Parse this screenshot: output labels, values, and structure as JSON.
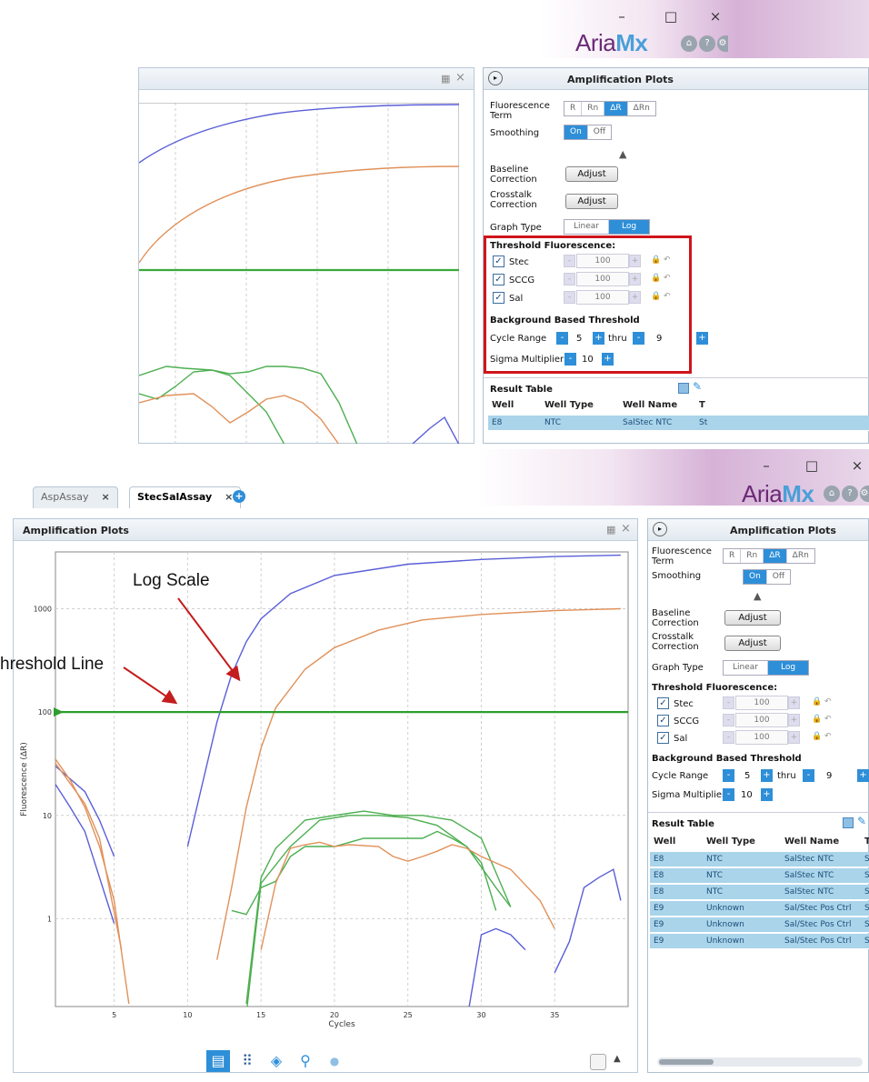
{
  "window": {
    "minimize": "–",
    "maximize": "□",
    "close": "×",
    "brand_prefix": "Aria",
    "brand_suffix": "Mx",
    "home_icon": "home-icon",
    "help_icon": "help-icon",
    "settings_icon": "settings-icon"
  },
  "tabs": [
    {
      "label": "AspAssay",
      "close": "×"
    },
    {
      "label": "StecSalAssay",
      "close": "×"
    }
  ],
  "add_tab": "+",
  "plot_panel": {
    "title": "Amplification Plots",
    "dock_icon": "▦",
    "close_icon": "×"
  },
  "controls": {
    "title": "Amplification Plots",
    "collapse_icon": "▸",
    "fluorescence_term_label": "Fluorescence Term",
    "fluorescence_term_options": [
      "R",
      "Rn",
      "ΔR",
      "ΔRn"
    ],
    "fluorescence_term_selected": "ΔR",
    "smoothing_label": "Smoothing",
    "smoothing_options": [
      "On",
      "Off"
    ],
    "smoothing_selected": "On",
    "expand_arrow": "▲",
    "baseline_label": "Baseline Correction",
    "baseline_button": "Adjust",
    "crosstalk_label": "Crosstalk Correction",
    "crosstalk_button": "Adjust",
    "graph_type_label": "Graph Type",
    "graph_type_options": [
      "Linear",
      "Log"
    ],
    "graph_type_selected": "Log",
    "threshold_title": "Threshold Fluorescence:",
    "thresholds": [
      {
        "name": "Stec",
        "value": "100",
        "checked": true
      },
      {
        "name": "SCCG",
        "value": "100",
        "checked": true
      },
      {
        "name": "Sal",
        "value": "100",
        "checked": true
      }
    ],
    "background_title": "Background Based Threshold",
    "cycle_range_label": "Cycle Range",
    "cycle_from": "5",
    "thru_label": "thru",
    "cycle_to": "9",
    "sigma_label": "Sigma Multiplier",
    "sigma_value": "10",
    "minus": "-",
    "plus": "+"
  },
  "result_table": {
    "title": "Result Table",
    "columns": [
      "Well",
      "Well Type",
      "Well Name",
      "T"
    ],
    "rows_top": [
      {
        "well": "E8",
        "type": "NTC",
        "name": "SalStec NTC",
        "t": "St"
      }
    ],
    "rows": [
      {
        "well": "E8",
        "type": "NTC",
        "name": "SalStec NTC",
        "t": "S"
      },
      {
        "well": "E8",
        "type": "NTC",
        "name": "SalStec NTC",
        "t": "S"
      },
      {
        "well": "E8",
        "type": "NTC",
        "name": "SalStec NTC",
        "t": "S"
      },
      {
        "well": "E9",
        "type": "Unknown",
        "name": "Sal/Stec Pos Ctrl",
        "t": "S"
      },
      {
        "well": "E9",
        "type": "Unknown",
        "name": "Sal/Stec Pos Ctrl",
        "t": "S"
      },
      {
        "well": "E9",
        "type": "Unknown",
        "name": "Sal/Stec Pos Ctrl",
        "t": "S"
      }
    ]
  },
  "annotations": {
    "log_scale": "Log Scale",
    "threshold_line": "hreshold Line"
  },
  "chart_data": {
    "type": "line",
    "xlabel": "Cycles",
    "ylabel": "Fluorescence (ΔR)",
    "x_ticks": [
      "5",
      "10",
      "15",
      "20",
      "25",
      "30",
      "35"
    ],
    "y_ticks": [
      "1000",
      "100",
      "10",
      "1"
    ],
    "threshold": 100,
    "xlim": [
      1,
      40
    ],
    "ylim_log10": [
      -0.85,
      3.55
    ],
    "scale": "log",
    "grid": true,
    "colors": {
      "blue": "#5a5fd6",
      "orange": "#e0915a",
      "green": "#4caf50",
      "threshold": "#2e9e2e"
    },
    "series": [
      {
        "color": "blue",
        "points": [
          [
            10,
            5
          ],
          [
            11,
            20
          ],
          [
            12,
            80
          ],
          [
            13,
            230
          ],
          [
            14,
            480
          ],
          [
            15,
            800
          ],
          [
            17,
            1400
          ],
          [
            20,
            2100
          ],
          [
            25,
            2700
          ],
          [
            30,
            3000
          ],
          [
            35,
            3200
          ],
          [
            39.5,
            3300
          ]
        ]
      },
      {
        "color": "orange",
        "points": [
          [
            12,
            0.4
          ],
          [
            13,
            2
          ],
          [
            14,
            12
          ],
          [
            15,
            45
          ],
          [
            16,
            110
          ],
          [
            18,
            260
          ],
          [
            20,
            420
          ],
          [
            23,
            620
          ],
          [
            26,
            780
          ],
          [
            30,
            880
          ],
          [
            35,
            960
          ],
          [
            39.5,
            1000
          ]
        ]
      },
      {
        "color": "blue",
        "points": [
          [
            1,
            20
          ],
          [
            2,
            12
          ],
          [
            3,
            7
          ],
          [
            4,
            2.5
          ],
          [
            5,
            0.9
          ]
        ]
      },
      {
        "color": "blue",
        "points": [
          [
            1,
            30
          ],
          [
            3,
            17
          ],
          [
            4,
            9
          ],
          [
            5,
            4
          ]
        ]
      },
      {
        "color": "orange",
        "points": [
          [
            1,
            35
          ],
          [
            2,
            22
          ],
          [
            3,
            12
          ],
          [
            4,
            5
          ],
          [
            5,
            1.5
          ],
          [
            6,
            0.15
          ]
        ]
      },
      {
        "color": "orange",
        "points": [
          [
            1,
            32
          ],
          [
            3,
            13
          ],
          [
            4,
            6
          ],
          [
            5.5,
            0.5
          ]
        ]
      },
      {
        "color": "green",
        "points": [
          [
            13,
            1.2
          ],
          [
            14,
            1.1
          ],
          [
            15,
            2
          ],
          [
            16,
            2.3
          ],
          [
            17,
            4
          ],
          [
            18,
            5
          ],
          [
            20,
            5
          ],
          [
            22,
            6
          ],
          [
            24,
            6
          ],
          [
            26,
            6
          ],
          [
            27,
            7
          ],
          [
            28,
            6
          ],
          [
            29,
            5
          ],
          [
            30,
            3.5
          ],
          [
            31,
            1.2
          ]
        ]
      },
      {
        "color": "green",
        "points": [
          [
            14,
            0.15
          ],
          [
            15,
            2.5
          ],
          [
            16,
            4.8
          ],
          [
            18,
            9
          ],
          [
            20,
            10
          ],
          [
            22,
            11
          ],
          [
            24,
            10
          ],
          [
            26,
            10
          ],
          [
            28,
            9
          ],
          [
            30,
            6
          ],
          [
            32,
            1.3
          ]
        ]
      },
      {
        "color": "green",
        "points": [
          [
            14,
            0.12
          ],
          [
            15,
            2.2
          ],
          [
            17,
            5
          ],
          [
            19,
            9
          ],
          [
            21,
            10
          ],
          [
            23,
            10
          ],
          [
            25,
            9.5
          ],
          [
            27,
            8
          ],
          [
            29,
            5
          ],
          [
            31,
            2
          ],
          [
            32,
            1.3
          ]
        ]
      },
      {
        "color": "orange",
        "points": [
          [
            15,
            0.5
          ],
          [
            16,
            2.2
          ],
          [
            17,
            4.8
          ],
          [
            18,
            5.2
          ],
          [
            19,
            5.5
          ],
          [
            20,
            5
          ],
          [
            21,
            5.2
          ],
          [
            23,
            5
          ],
          [
            24,
            4
          ],
          [
            25,
            3.6
          ],
          [
            26,
            4
          ],
          [
            27,
            4.5
          ],
          [
            28,
            5.2
          ],
          [
            29,
            4.8
          ],
          [
            30,
            4
          ],
          [
            32,
            3
          ],
          [
            34,
            1.5
          ],
          [
            35,
            0.8
          ]
        ]
      },
      {
        "color": "blue",
        "points": [
          [
            29,
            0.1
          ],
          [
            30,
            0.7
          ],
          [
            31,
            0.8
          ],
          [
            32,
            0.7
          ],
          [
            33,
            0.5
          ]
        ]
      },
      {
        "color": "blue",
        "points": [
          [
            35,
            0.3
          ],
          [
            36,
            0.6
          ],
          [
            37,
            2
          ],
          [
            38,
            2.5
          ],
          [
            39,
            3
          ],
          [
            39.5,
            1.5
          ]
        ]
      }
    ]
  }
}
